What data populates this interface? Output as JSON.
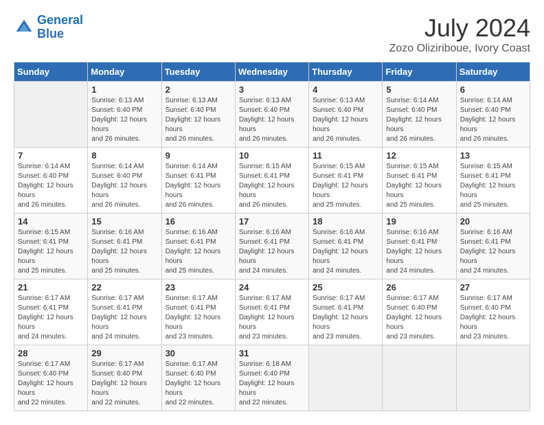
{
  "header": {
    "logo_line1": "General",
    "logo_line2": "Blue",
    "month_year": "July 2024",
    "location": "Zozo Oliziriboue, Ivory Coast"
  },
  "days_of_week": [
    "Sunday",
    "Monday",
    "Tuesday",
    "Wednesday",
    "Thursday",
    "Friday",
    "Saturday"
  ],
  "weeks": [
    [
      {
        "day": "",
        "sunrise": "",
        "sunset": "",
        "daylight": ""
      },
      {
        "day": "1",
        "sunrise": "Sunrise: 6:13 AM",
        "sunset": "Sunset: 6:40 PM",
        "daylight": "Daylight: 12 hours and 26 minutes."
      },
      {
        "day": "2",
        "sunrise": "Sunrise: 6:13 AM",
        "sunset": "Sunset: 6:40 PM",
        "daylight": "Daylight: 12 hours and 26 minutes."
      },
      {
        "day": "3",
        "sunrise": "Sunrise: 6:13 AM",
        "sunset": "Sunset: 6:40 PM",
        "daylight": "Daylight: 12 hours and 26 minutes."
      },
      {
        "day": "4",
        "sunrise": "Sunrise: 6:13 AM",
        "sunset": "Sunset: 6:40 PM",
        "daylight": "Daylight: 12 hours and 26 minutes."
      },
      {
        "day": "5",
        "sunrise": "Sunrise: 6:14 AM",
        "sunset": "Sunset: 6:40 PM",
        "daylight": "Daylight: 12 hours and 26 minutes."
      },
      {
        "day": "6",
        "sunrise": "Sunrise: 6:14 AM",
        "sunset": "Sunset: 6:40 PM",
        "daylight": "Daylight: 12 hours and 26 minutes."
      }
    ],
    [
      {
        "day": "7",
        "sunrise": "Sunrise: 6:14 AM",
        "sunset": "Sunset: 6:40 PM",
        "daylight": "Daylight: 12 hours and 26 minutes."
      },
      {
        "day": "8",
        "sunrise": "Sunrise: 6:14 AM",
        "sunset": "Sunset: 6:40 PM",
        "daylight": "Daylight: 12 hours and 26 minutes."
      },
      {
        "day": "9",
        "sunrise": "Sunrise: 6:14 AM",
        "sunset": "Sunset: 6:41 PM",
        "daylight": "Daylight: 12 hours and 26 minutes."
      },
      {
        "day": "10",
        "sunrise": "Sunrise: 6:15 AM",
        "sunset": "Sunset: 6:41 PM",
        "daylight": "Daylight: 12 hours and 26 minutes."
      },
      {
        "day": "11",
        "sunrise": "Sunrise: 6:15 AM",
        "sunset": "Sunset: 6:41 PM",
        "daylight": "Daylight: 12 hours and 25 minutes."
      },
      {
        "day": "12",
        "sunrise": "Sunrise: 6:15 AM",
        "sunset": "Sunset: 6:41 PM",
        "daylight": "Daylight: 12 hours and 25 minutes."
      },
      {
        "day": "13",
        "sunrise": "Sunrise: 6:15 AM",
        "sunset": "Sunset: 6:41 PM",
        "daylight": "Daylight: 12 hours and 25 minutes."
      }
    ],
    [
      {
        "day": "14",
        "sunrise": "Sunrise: 6:15 AM",
        "sunset": "Sunset: 6:41 PM",
        "daylight": "Daylight: 12 hours and 25 minutes."
      },
      {
        "day": "15",
        "sunrise": "Sunrise: 6:16 AM",
        "sunset": "Sunset: 6:41 PM",
        "daylight": "Daylight: 12 hours and 25 minutes."
      },
      {
        "day": "16",
        "sunrise": "Sunrise: 6:16 AM",
        "sunset": "Sunset: 6:41 PM",
        "daylight": "Daylight: 12 hours and 25 minutes."
      },
      {
        "day": "17",
        "sunrise": "Sunrise: 6:16 AM",
        "sunset": "Sunset: 6:41 PM",
        "daylight": "Daylight: 12 hours and 24 minutes."
      },
      {
        "day": "18",
        "sunrise": "Sunrise: 6:16 AM",
        "sunset": "Sunset: 6:41 PM",
        "daylight": "Daylight: 12 hours and 24 minutes."
      },
      {
        "day": "19",
        "sunrise": "Sunrise: 6:16 AM",
        "sunset": "Sunset: 6:41 PM",
        "daylight": "Daylight: 12 hours and 24 minutes."
      },
      {
        "day": "20",
        "sunrise": "Sunrise: 6:16 AM",
        "sunset": "Sunset: 6:41 PM",
        "daylight": "Daylight: 12 hours and 24 minutes."
      }
    ],
    [
      {
        "day": "21",
        "sunrise": "Sunrise: 6:17 AM",
        "sunset": "Sunset: 6:41 PM",
        "daylight": "Daylight: 12 hours and 24 minutes."
      },
      {
        "day": "22",
        "sunrise": "Sunrise: 6:17 AM",
        "sunset": "Sunset: 6:41 PM",
        "daylight": "Daylight: 12 hours and 24 minutes."
      },
      {
        "day": "23",
        "sunrise": "Sunrise: 6:17 AM",
        "sunset": "Sunset: 6:41 PM",
        "daylight": "Daylight: 12 hours and 23 minutes."
      },
      {
        "day": "24",
        "sunrise": "Sunrise: 6:17 AM",
        "sunset": "Sunset: 6:41 PM",
        "daylight": "Daylight: 12 hours and 23 minutes."
      },
      {
        "day": "25",
        "sunrise": "Sunrise: 6:17 AM",
        "sunset": "Sunset: 6:41 PM",
        "daylight": "Daylight: 12 hours and 23 minutes."
      },
      {
        "day": "26",
        "sunrise": "Sunrise: 6:17 AM",
        "sunset": "Sunset: 6:40 PM",
        "daylight": "Daylight: 12 hours and 23 minutes."
      },
      {
        "day": "27",
        "sunrise": "Sunrise: 6:17 AM",
        "sunset": "Sunset: 6:40 PM",
        "daylight": "Daylight: 12 hours and 23 minutes."
      }
    ],
    [
      {
        "day": "28",
        "sunrise": "Sunrise: 6:17 AM",
        "sunset": "Sunset: 6:40 PM",
        "daylight": "Daylight: 12 hours and 22 minutes."
      },
      {
        "day": "29",
        "sunrise": "Sunrise: 6:17 AM",
        "sunset": "Sunset: 6:40 PM",
        "daylight": "Daylight: 12 hours and 22 minutes."
      },
      {
        "day": "30",
        "sunrise": "Sunrise: 6:17 AM",
        "sunset": "Sunset: 6:40 PM",
        "daylight": "Daylight: 12 hours and 22 minutes."
      },
      {
        "day": "31",
        "sunrise": "Sunrise: 6:18 AM",
        "sunset": "Sunset: 6:40 PM",
        "daylight": "Daylight: 12 hours and 22 minutes."
      },
      {
        "day": "",
        "sunrise": "",
        "sunset": "",
        "daylight": ""
      },
      {
        "day": "",
        "sunrise": "",
        "sunset": "",
        "daylight": ""
      },
      {
        "day": "",
        "sunrise": "",
        "sunset": "",
        "daylight": ""
      }
    ]
  ]
}
